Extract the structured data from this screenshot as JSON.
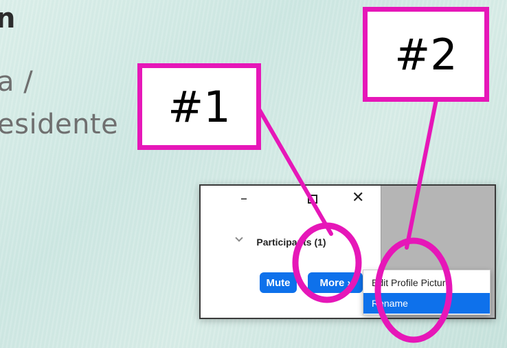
{
  "background": {
    "heading_fragment": "n",
    "line1": "a /",
    "line2": "esidente"
  },
  "window": {
    "minimize_icon": "minimize-icon",
    "maximize_icon": "maximize-icon",
    "close_icon": "close-icon",
    "minimize_glyph": "–",
    "close_glyph": "✕",
    "collapse_icon": "chevron-down-icon",
    "title": "Participants (1)",
    "mute_label": "Mute",
    "more_label": "More ›"
  },
  "dropdown": {
    "items": [
      {
        "label": "Edit Profile Picture",
        "selected": false
      },
      {
        "label": "Rename",
        "selected": true
      }
    ]
  },
  "annotations": {
    "label1": "#1",
    "label2": "#2",
    "color": "#e617b8"
  },
  "colors": {
    "accent": "#0e71eb",
    "annotation": "#e617b8"
  }
}
